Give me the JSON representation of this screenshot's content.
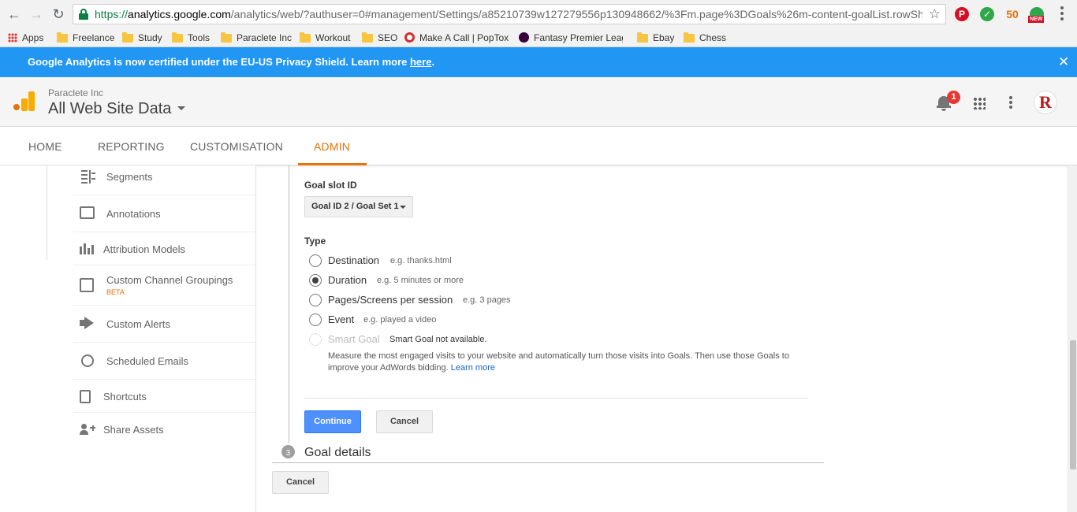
{
  "browser": {
    "url_scheme": "https://",
    "url_host": "analytics.google.com",
    "url_rest": "/analytics/web/?authuser=0#management/Settings/a85210739w127279556p130948662/%3Fm.page%3DGoals%26m-content-goalList.rowShc",
    "ext_new_badge": "NEW",
    "ext_orange_text": "50",
    "bookmarks": [
      {
        "label": "Apps",
        "icon": "apps-grid-icon"
      },
      {
        "label": "Freelance",
        "icon": "folder-icon"
      },
      {
        "label": "Study",
        "icon": "folder-icon"
      },
      {
        "label": "Tools",
        "icon": "folder-icon"
      },
      {
        "label": "Paraclete Inc",
        "icon": "folder-icon"
      },
      {
        "label": "Workout",
        "icon": "folder-icon"
      },
      {
        "label": "SEO",
        "icon": "folder-icon"
      },
      {
        "label": "Make A Call | PopTox",
        "icon": "target-icon"
      },
      {
        "label": "Fantasy Premier Leagu",
        "icon": "premier-league-icon"
      },
      {
        "label": "Ebay",
        "icon": "folder-icon"
      },
      {
        "label": "Chess",
        "icon": "folder-icon"
      }
    ]
  },
  "banner": {
    "text": "Google Analytics is now certified under the EU-US Privacy Shield. Learn more ",
    "link": "here",
    "suffix": ".",
    "close": "✕",
    "color": "#2196f3"
  },
  "header": {
    "account": "Paraclete Inc",
    "property": "All Web Site Data",
    "notification_count": "1",
    "avatar_letter": "R"
  },
  "nav": {
    "tabs": [
      "HOME",
      "REPORTING",
      "CUSTOMISATION",
      "ADMIN"
    ],
    "active_tab": "ADMIN",
    "accent": "#e8710a"
  },
  "sidebar": {
    "items": [
      {
        "label": "Segments",
        "icon": "segments-icon"
      },
      {
        "label": "Annotations",
        "icon": "annotations-icon"
      },
      {
        "label": "Attribution Models",
        "icon": "bar-chart-icon"
      },
      {
        "label": "Custom Channel Groupings",
        "badge": "BETA",
        "icon": "channel-groupings-icon"
      },
      {
        "label": "Custom Alerts",
        "icon": "megaphone-icon"
      },
      {
        "label": "Scheduled Emails",
        "icon": "alarm-clock-icon"
      },
      {
        "label": "Shortcuts",
        "icon": "document-icon"
      },
      {
        "label": "Share Assets",
        "icon": "add-person-icon"
      }
    ]
  },
  "goal_form": {
    "slot_label": "Goal slot ID",
    "slot_value": "Goal ID 2 / Goal Set 1",
    "type_label": "Type",
    "types": [
      {
        "label": "Destination",
        "hint": "e.g. thanks.html",
        "checked": false,
        "disabled": false
      },
      {
        "label": "Duration",
        "hint": "e.g. 5 minutes or more",
        "checked": true,
        "disabled": false
      },
      {
        "label": "Pages/Screens per session",
        "hint": "e.g. 3 pages",
        "checked": false,
        "disabled": false
      },
      {
        "label": "Event",
        "hint": "e.g. played a video",
        "checked": false,
        "disabled": false
      },
      {
        "label": "Smart Goal",
        "hint": "Smart Goal not available.",
        "checked": false,
        "disabled": true
      }
    ],
    "smart_goal_description": "Measure the most engaged visits to your website and automatically turn those visits into Goals. Then use those Goals to improve your AdWords bidding. ",
    "smart_goal_link": "Learn more",
    "continue_label": "Continue",
    "cancel_label": "Cancel",
    "step_number": "3",
    "step_title": "Goal details",
    "bottom_cancel_label": "Cancel"
  }
}
